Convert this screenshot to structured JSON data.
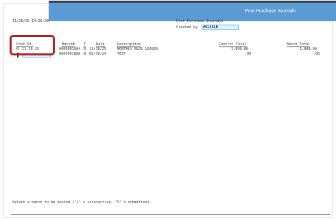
{
  "app": {
    "title": "Post Purchase Journals"
  },
  "header": {
    "datetime": "11/10/25 14:26:08",
    "screen_title": "Post Purchase Journals",
    "created_by_label": "Created by",
    "created_by_value": "#GL4GLB"
  },
  "table": {
    "columns": [
      "Post Dt.",
      "Batch#",
      "T",
      "Date",
      "Description",
      "Control Total",
      "Batch Total"
    ],
    "rows": [
      {
        "select": "B",
        "post_dt": "11 10 25",
        "batch": "0000061984",
        "type": "R",
        "date": "11/10/25",
        "description": "MONTHLY BLDG LEASES",
        "control_total": "1,000.00",
        "batch_total": "1,000.00"
      },
      {
        "select": "",
        "post_dt": "",
        "batch": "0000061888",
        "type": "N",
        "date": "09/30/24",
        "description": "TEST",
        "control_total": ".00",
        "batch_total": ".00"
      }
    ]
  },
  "footer": {
    "instructions": "Select a batch to be posted (\"1\" = interactive, \"5\" = submitted)."
  }
}
